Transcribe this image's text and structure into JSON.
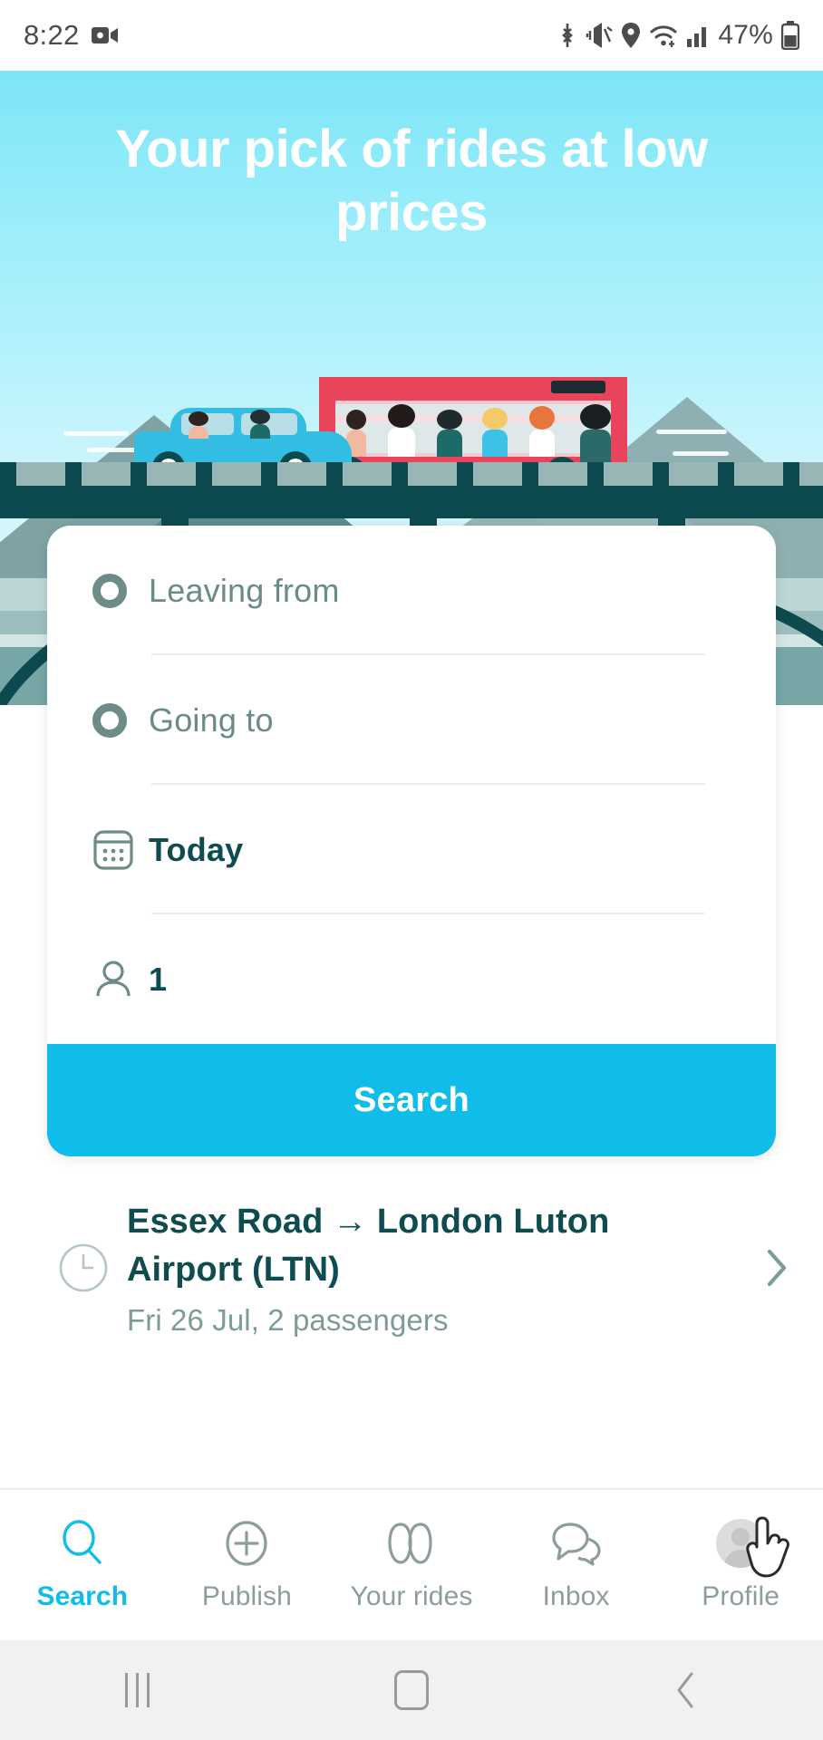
{
  "statusbar": {
    "time": "8:22",
    "battery_pct": "47%",
    "icons": [
      "video-camera-icon",
      "bluetooth-icon",
      "vibrate-icon",
      "location-icon",
      "wifi-icon",
      "cellular-signal-icon",
      "battery-icon"
    ]
  },
  "hero": {
    "title": "Your pick of rides at low prices",
    "sky_color": "#9deefb",
    "illustration": "car-and-bus-on-bridge-illustration"
  },
  "search_card": {
    "leaving_from": {
      "placeholder": "Leaving from",
      "value": "",
      "icon": "circle-outline-icon"
    },
    "going_to": {
      "placeholder": "Going to",
      "value": "",
      "icon": "circle-outline-icon"
    },
    "date": {
      "value": "Today",
      "icon": "calendar-icon"
    },
    "passengers": {
      "value": "1",
      "icon": "person-icon"
    },
    "search_button": {
      "label": "Search",
      "color": "#10bcea"
    }
  },
  "recent_search": {
    "icon": "clock-icon",
    "title": "Essex Road → London Luton Airport (LTN)",
    "subtitle": "Fri 26 Jul, 2 passengers",
    "chevron": "chevron-right-icon"
  },
  "bottom_nav": {
    "active_color": "#10bcea",
    "items": [
      {
        "label": "Search",
        "icon": "search-icon",
        "active": true
      },
      {
        "label": "Publish",
        "icon": "plus-circle-icon",
        "active": false
      },
      {
        "label": "Your rides",
        "icon": "your-rides-icon",
        "active": false
      },
      {
        "label": "Inbox",
        "icon": "chat-bubble-icon",
        "active": false
      },
      {
        "label": "Profile",
        "icon": "avatar-icon",
        "active": false
      }
    ]
  },
  "android_nav": {
    "recents": "recents-icon",
    "home": "home-icon",
    "back": "back-icon"
  }
}
